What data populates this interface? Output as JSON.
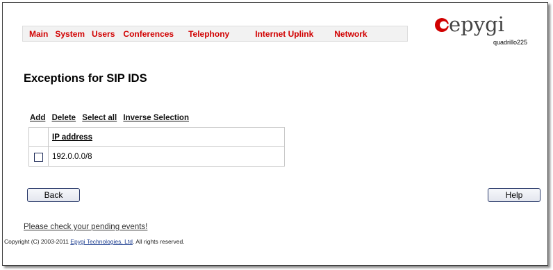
{
  "menu": {
    "items": [
      "Main",
      "System",
      "Users",
      "Conferences",
      "Telephony",
      "Internet Uplink",
      "Network"
    ]
  },
  "logo": {
    "brand": "epygi",
    "device": "quadrillo225",
    "color": "#d10000"
  },
  "page": {
    "title": "Exceptions for SIP IDS"
  },
  "actions": {
    "add": "Add",
    "delete": "Delete",
    "select_all": "Select all",
    "inverse": "Inverse Selection"
  },
  "table": {
    "column_header": "IP address",
    "rows": [
      {
        "checked": false,
        "ip": "192.0.0.0/8"
      }
    ]
  },
  "buttons": {
    "back": "Back",
    "help": "Help"
  },
  "pending_link": "Please check your pending events!",
  "copyright": {
    "prefix": "Copyright (C) 2003-2011",
    "company": "Epygi Technologies, Ltd",
    "suffix": ". All rights reserved."
  }
}
